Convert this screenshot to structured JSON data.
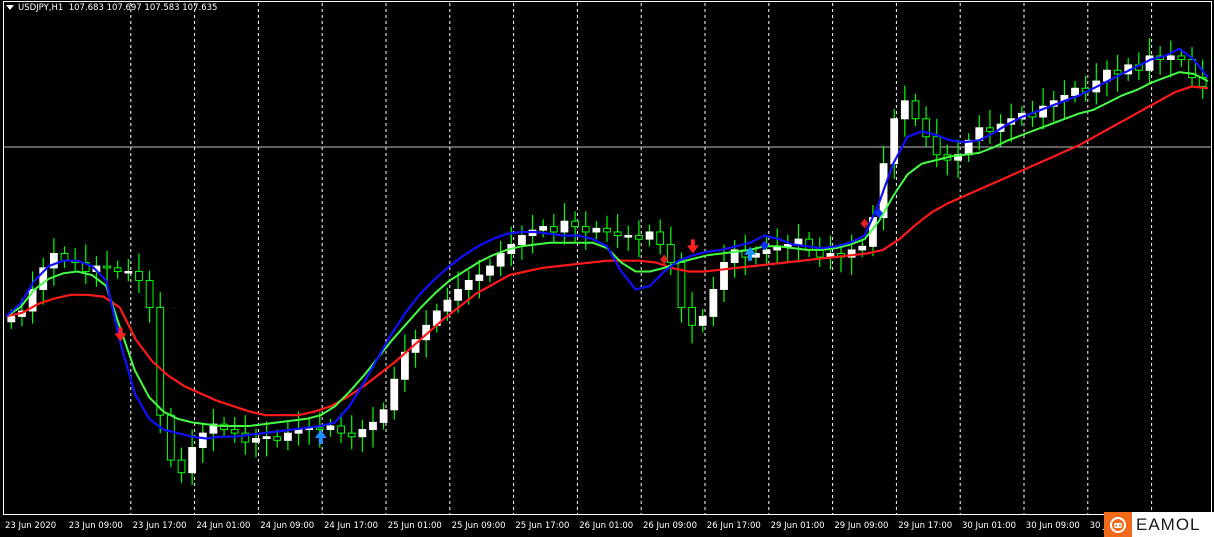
{
  "header": {
    "symbol": "USDJPY,H1",
    "ohlc": "107.683 107.697 107.583 107.635"
  },
  "watermark": {
    "text": "EAMOL"
  },
  "colors": {
    "background": "#000000",
    "bull_candle": "#ffffff",
    "bear_candle": "#00ff00",
    "wick": "#00ff00",
    "ma_fast": "#1010ff",
    "ma_mid": "#44ff44",
    "ma_slow": "#ff1a1a",
    "buy_arrow": "#1e90ff",
    "sell_arrow": "#ff2020",
    "grid": "#ffffff",
    "frame": "#ffffff"
  },
  "chart_data": {
    "type": "candlestick",
    "title": "USDJPY,H1",
    "x_tick_labels": [
      "23 Jun 2020",
      "23 Jun 09:00",
      "23 Jun 17:00",
      "24 Jun 01:00",
      "24 Jun 09:00",
      "24 Jun 17:00",
      "25 Jun 01:00",
      "25 Jun 09:00",
      "25 Jun 17:00",
      "26 Jun 01:00",
      "26 Jun 09:00",
      "26 Jun 17:00",
      "29 Jun 01:00",
      "29 Jun 09:00",
      "29 Jun 17:00",
      "30 Jun 01:00",
      "30 Jun 09:00",
      "30 Jun 17:00"
    ],
    "current_price_line": 107.635,
    "candles_close": [
      106.35,
      106.38,
      106.5,
      106.62,
      106.7,
      106.66,
      106.65,
      106.6,
      106.63,
      106.62,
      106.6,
      106.6,
      106.55,
      106.4,
      105.8,
      105.55,
      105.48,
      105.62,
      105.7,
      105.75,
      105.72,
      105.7,
      105.65,
      105.67,
      105.68,
      105.66,
      105.7,
      105.72,
      105.73,
      105.72,
      105.74,
      105.7,
      105.68,
      105.72,
      105.76,
      105.83,
      106.0,
      106.15,
      106.22,
      106.3,
      106.38,
      106.44,
      106.5,
      106.55,
      106.58,
      106.63,
      106.7,
      106.75,
      106.8,
      106.83,
      106.85,
      106.82,
      106.88,
      106.85,
      106.82,
      106.84,
      106.82,
      106.8,
      106.8,
      106.78,
      106.82,
      106.75,
      106.65,
      106.4,
      106.3,
      106.35,
      106.5,
      106.65,
      106.72,
      106.68,
      106.7,
      106.72,
      106.74,
      106.75,
      106.78,
      106.72,
      106.68,
      106.7,
      106.68,
      106.72,
      106.74,
      106.9,
      107.2,
      107.45,
      107.55,
      107.45,
      107.35,
      107.25,
      107.22,
      107.25,
      107.33,
      107.4,
      107.38,
      107.42,
      107.45,
      107.48,
      107.46,
      107.52,
      107.55,
      107.58,
      107.62,
      107.6,
      107.66,
      107.72,
      107.7,
      107.75,
      107.72,
      107.8,
      107.78,
      107.8,
      107.78,
      107.68,
      107.63
    ],
    "ma_fast": [
      106.35,
      106.42,
      106.55,
      106.63,
      106.66,
      106.66,
      106.63,
      106.55,
      106.2,
      105.92,
      105.78,
      105.72,
      105.7,
      105.68,
      105.67,
      105.68,
      105.68,
      105.69,
      105.7,
      105.71,
      105.72,
      105.73,
      105.74,
      105.76,
      105.85,
      105.98,
      106.12,
      106.26,
      106.38,
      106.48,
      106.56,
      106.63,
      106.69,
      106.74,
      106.78,
      106.81,
      106.82,
      106.82,
      106.81,
      106.8,
      106.8,
      106.78,
      106.74,
      106.6,
      106.5,
      106.52,
      106.6,
      106.66,
      106.69,
      106.71,
      106.72,
      106.74,
      106.76,
      106.8,
      106.78,
      106.75,
      106.74,
      106.73,
      106.74,
      106.76,
      106.8,
      106.98,
      107.2,
      107.35,
      107.38,
      107.36,
      107.33,
      107.32,
      107.33,
      107.37,
      107.42,
      107.46,
      107.49,
      107.52,
      107.55,
      107.58,
      107.62,
      107.66,
      107.7,
      107.74,
      107.78,
      107.8,
      107.84,
      107.78,
      107.68
    ],
    "ma_mid": [
      106.35,
      106.4,
      106.5,
      106.56,
      106.59,
      106.6,
      106.58,
      106.52,
      106.28,
      106.05,
      105.9,
      105.82,
      105.78,
      105.76,
      105.75,
      105.74,
      105.74,
      105.74,
      105.75,
      105.76,
      105.77,
      105.78,
      105.8,
      105.85,
      105.93,
      106.02,
      106.12,
      106.22,
      106.31,
      106.4,
      106.48,
      106.55,
      106.6,
      106.65,
      106.69,
      106.72,
      106.74,
      106.75,
      106.76,
      106.76,
      106.76,
      106.76,
      106.73,
      106.65,
      106.6,
      106.6,
      106.62,
      106.65,
      106.67,
      106.69,
      106.7,
      106.71,
      106.72,
      106.74,
      106.74,
      106.73,
      106.72,
      106.72,
      106.73,
      106.75,
      106.78,
      106.88,
      107.02,
      107.14,
      107.2,
      107.22,
      107.24,
      107.25,
      107.26,
      107.29,
      107.33,
      107.36,
      107.39,
      107.42,
      107.45,
      107.48,
      107.5,
      107.54,
      107.58,
      107.61,
      107.65,
      107.68,
      107.71,
      107.7,
      107.66
    ],
    "ma_slow": [
      106.35,
      106.37,
      106.42,
      106.45,
      106.47,
      106.47,
      106.46,
      106.4,
      106.22,
      106.1,
      106.02,
      105.96,
      105.92,
      105.88,
      105.85,
      105.82,
      105.8,
      105.8,
      105.8,
      105.82,
      105.85,
      105.9,
      105.96,
      106.03,
      106.1,
      106.18,
      106.26,
      106.34,
      106.41,
      106.48,
      106.53,
      106.58,
      106.6,
      106.62,
      106.63,
      106.64,
      106.65,
      106.66,
      106.66,
      106.66,
      106.65,
      106.62,
      106.6,
      106.6,
      106.61,
      106.62,
      106.63,
      106.64,
      106.65,
      106.66,
      106.67,
      106.68,
      106.69,
      106.7,
      106.72,
      106.78,
      106.86,
      106.93,
      106.98,
      107.02,
      107.06,
      107.1,
      107.14,
      107.18,
      107.22,
      107.26,
      107.3,
      107.35,
      107.4,
      107.45,
      107.5,
      107.55,
      107.6,
      107.63,
      107.62
    ],
    "signals": [
      {
        "type": "sell-arrow",
        "index": 8
      },
      {
        "type": "buy-arrow",
        "index": 22
      },
      {
        "type": "sell-diamond",
        "index": 46
      },
      {
        "type": "sell-arrow",
        "index": 48
      },
      {
        "type": "buy-arrow",
        "index": 52
      },
      {
        "type": "buy-diamond",
        "index": 53
      },
      {
        "type": "sell-diamond",
        "index": 60
      },
      {
        "type": "buy-diamond",
        "index": 61
      }
    ],
    "grid": true
  }
}
